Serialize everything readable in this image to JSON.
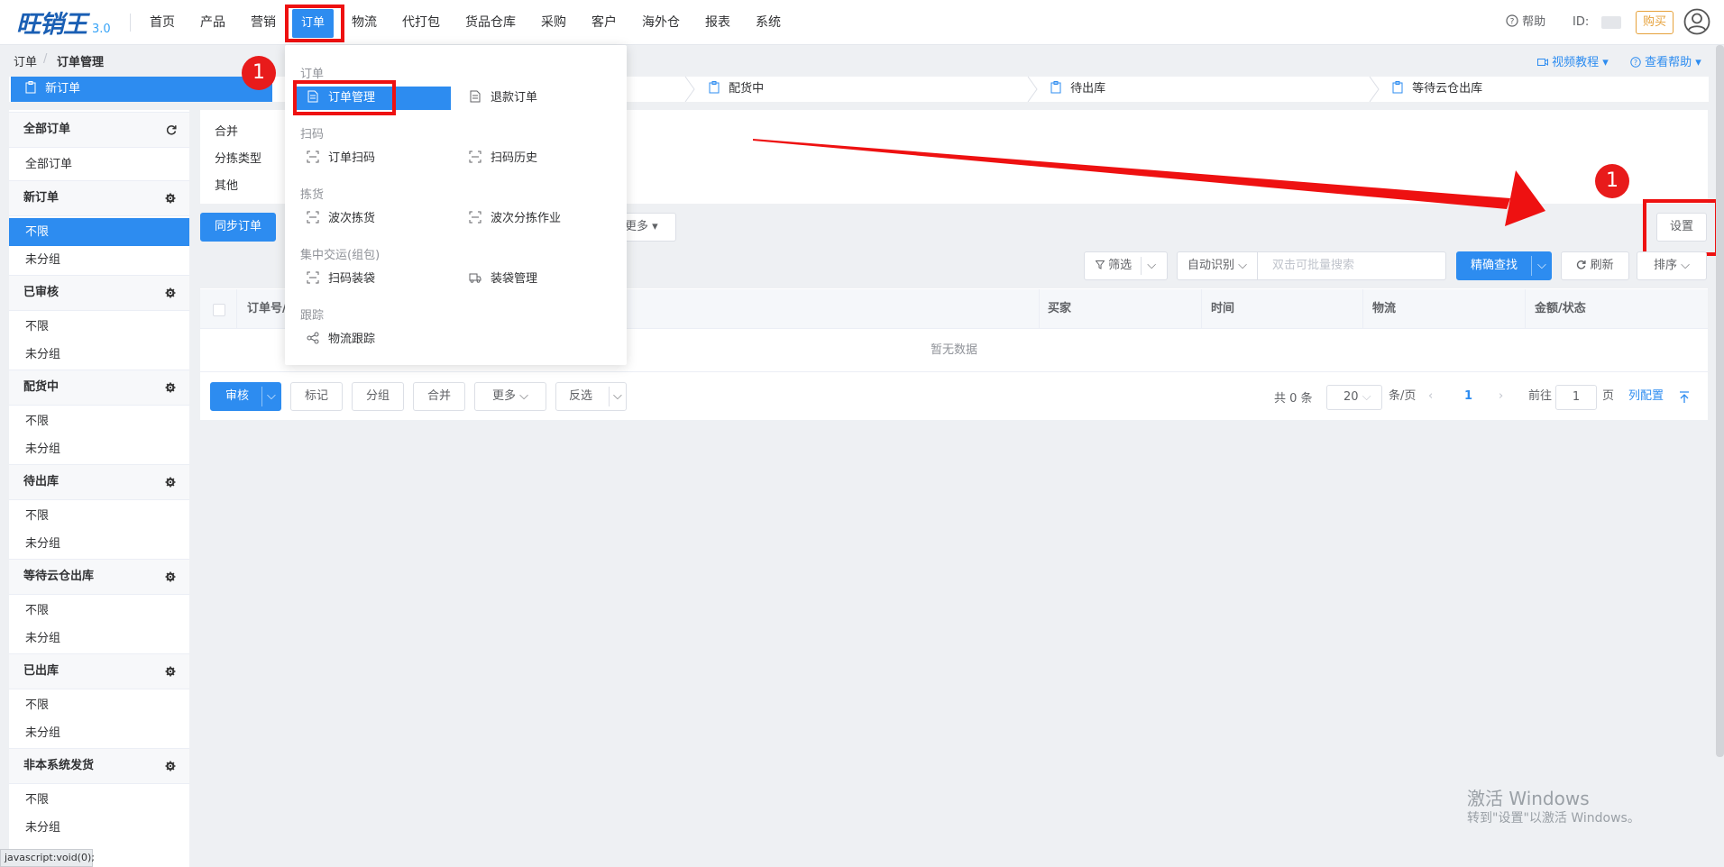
{
  "header": {
    "logo_text": "旺销王",
    "logo_version": "3.0",
    "nav": [
      "首页",
      "产品",
      "营销",
      "订单",
      "物流",
      "代打包",
      "货品仓库",
      "采购",
      "客户",
      "海外仓",
      "报表",
      "系统"
    ],
    "active_nav": "订单",
    "help": "帮助",
    "id_label": "ID:",
    "buy": "购买"
  },
  "breadcrumb": {
    "root": "订单",
    "sep": "/",
    "current": "订单管理"
  },
  "help_links": {
    "video": "视频教程",
    "docs": "查看帮助"
  },
  "steps": [
    "新订单",
    "配货中",
    "待出库",
    "等待云仓出库"
  ],
  "sidebar": {
    "all": {
      "header": "全部订单",
      "items": [
        "全部订单"
      ]
    },
    "groups": [
      {
        "header": "新订单",
        "items": [
          "不限",
          "未分组"
        ],
        "active": "不限"
      },
      {
        "header": "已审核",
        "items": [
          "不限",
          "未分组"
        ]
      },
      {
        "header": "配货中",
        "items": [
          "不限",
          "未分组"
        ]
      },
      {
        "header": "待出库",
        "items": [
          "不限",
          "未分组"
        ]
      },
      {
        "header": "等待云仓出库",
        "items": [
          "不限",
          "未分组"
        ]
      },
      {
        "header": "已出库",
        "items": [
          "不限",
          "未分组"
        ]
      },
      {
        "header": "非本系统发货",
        "items": [
          "不限",
          "未分组"
        ]
      }
    ]
  },
  "filters": {
    "merge": "合并",
    "sort_type": "分拣类型",
    "other": "其他"
  },
  "actions": {
    "sync": "同步订单",
    "more": "更多",
    "settings": "设置"
  },
  "search": {
    "filter": "筛选",
    "auto": "自动识别",
    "placeholder": "双击可批量搜索",
    "exact": "精确查找",
    "refresh": "刷新",
    "sort": "排序"
  },
  "table": {
    "columns": [
      "订单号/",
      "买家",
      "时间",
      "物流",
      "金额/状态"
    ],
    "empty": "暂无数据"
  },
  "bulk": {
    "review": "审核",
    "mark": "标记",
    "group": "分组",
    "merge": "合并",
    "more": "更多",
    "invert": "反选"
  },
  "pagination": {
    "total": "共 0 条",
    "page_size": "20",
    "per_page": "条/页",
    "current": "1",
    "goto": "前往",
    "goto_value": "1",
    "page_unit": "页",
    "column_config": "列配置"
  },
  "dropdown": {
    "sections": [
      {
        "title": "订单",
        "items": [
          "订单管理",
          "退款订单"
        ]
      },
      {
        "title": "扫码",
        "items": [
          "订单扫码",
          "扫码历史"
        ]
      },
      {
        "title": "拣货",
        "items": [
          "波次拣货",
          "波次分拣作业"
        ]
      },
      {
        "title": "集中交运(组包)",
        "items": [
          "扫码装袋",
          "装袋管理"
        ]
      },
      {
        "title": "跟踪",
        "items": [
          "物流跟踪"
        ]
      }
    ],
    "active": "订单管理"
  },
  "annotations": {
    "badge_1": "1",
    "badge_2": "1"
  },
  "watermark": {
    "line1": "激活 Windows",
    "line2": "转到\"设置\"以激活 Windows。"
  },
  "statusbar": "javascript:void(0);",
  "colors": {
    "primary": "#2d8cf0",
    "annotation_red": "#ee1111"
  }
}
